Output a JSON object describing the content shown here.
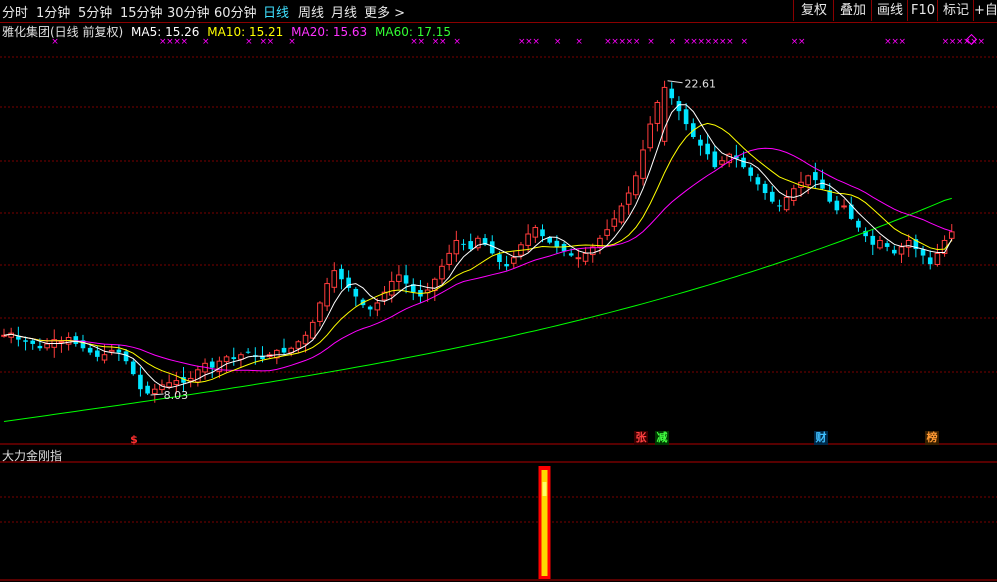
{
  "toolbar": {
    "periods": [
      "分时",
      "1分钟",
      "5分钟",
      "15分钟",
      "30分钟",
      "60分钟",
      "日线",
      "周线",
      "月线",
      "更多 >"
    ],
    "active_period": "日线",
    "buttons": [
      "复权",
      "叠加",
      "画线",
      "F10",
      "标记",
      "+自选"
    ]
  },
  "legend": {
    "stock": "雅化集团(日线 前复权)",
    "ma5": "MA5: 15.26",
    "ma10": "MA10: 15.21",
    "ma20": "MA20: 15.63",
    "ma60": "MA60: 17.15"
  },
  "colors": {
    "up": "#ff3c3c",
    "down": "#00e5ff",
    "ma5": "#ffffff",
    "ma10": "#ffff00",
    "ma20": "#ff00ff",
    "ma60": "#00ff00",
    "grid": "#7a0000",
    "signal_x": "#ff00ff"
  },
  "price_labels": {
    "high": "22.61",
    "low": "8.03"
  },
  "markers": {
    "s": "$",
    "zhang": "张",
    "jian": "减",
    "cai": "财",
    "bang": "榜"
  },
  "indicator": {
    "title": "大力金刚指"
  },
  "chart_data": {
    "type": "candlestick",
    "price_range": [
      6.5,
      24.5
    ],
    "high_value": 22.61,
    "low_value": 8.03,
    "ma": {
      "ma5": 15.26,
      "ma10": 15.21,
      "ma20": 15.63,
      "ma60": 17.15
    },
    "close_trend": [
      10.8,
      10.9,
      10.6,
      10.5,
      10.4,
      10.2,
      10.4,
      10.6,
      10.5,
      10.7,
      10.4,
      10.2,
      10.0,
      9.8,
      9.9,
      10.1,
      10.0,
      9.6,
      9.0,
      8.3,
      8.1,
      8.3,
      8.5,
      8.6,
      8.7,
      8.6,
      8.8,
      9.2,
      9.5,
      9.3,
      9.6,
      9.8,
      9.7,
      9.9,
      10.0,
      9.8,
      9.7,
      9.9,
      10.1,
      10.0,
      10.2,
      10.5,
      10.8,
      11.4,
      12.3,
      13.2,
      13.8,
      13.4,
      13.0,
      12.6,
      12.2,
      12.0,
      12.3,
      12.8,
      13.3,
      13.6,
      13.2,
      12.8,
      12.6,
      12.9,
      13.4,
      14.0,
      14.6,
      15.2,
      15.0,
      14.8,
      15.3,
      15.0,
      14.6,
      14.2,
      14.0,
      14.4,
      15.0,
      15.5,
      15.8,
      15.4,
      15.1,
      14.9,
      14.7,
      14.5,
      14.4,
      14.6,
      14.9,
      15.3,
      15.7,
      16.2,
      16.8,
      17.4,
      18.2,
      19.4,
      20.6,
      21.6,
      22.3,
      21.8,
      21.2,
      20.6,
      20.0,
      19.6,
      19.2,
      18.6,
      18.9,
      19.2,
      19.0,
      18.6,
      18.2,
      17.8,
      17.4,
      17.0,
      16.8,
      17.2,
      17.6,
      17.9,
      18.2,
      18.0,
      17.6,
      17.0,
      16.6,
      16.8,
      16.2,
      15.8,
      15.4,
      15.0,
      15.2,
      14.9,
      14.6,
      14.9,
      15.2,
      14.8,
      14.5,
      14.1,
      14.6,
      15.2,
      15.6
    ],
    "signal_x_days": [
      7,
      22,
      23,
      24,
      25,
      28,
      34,
      36,
      37,
      40,
      57,
      58,
      60,
      61,
      63,
      72,
      73,
      74,
      77,
      80,
      84,
      85,
      86,
      87,
      88,
      90,
      93,
      95,
      96,
      97,
      98,
      99,
      100,
      101,
      103,
      110,
      111,
      123,
      124,
      125,
      131,
      132,
      133,
      134,
      135,
      136
    ]
  }
}
